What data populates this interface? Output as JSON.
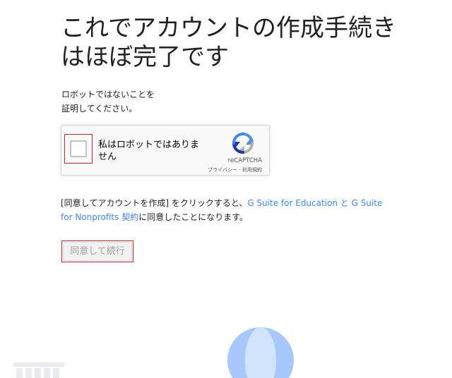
{
  "heading": {
    "title": "これでアカウントの作成手続きはほぼ完了です"
  },
  "instructions": {
    "text": "ロボットではないことを\n証明してください。"
  },
  "recaptcha": {
    "checkbox_label": "私はロボットではありません",
    "brand": "reCAPTCHA",
    "privacy_terms": "プライバシー - 利用規約",
    "checked": false
  },
  "agreement": {
    "prefix": "[同意してアカウントを作成] をクリックすると、",
    "link1": "G Suite for Education",
    "middle": " と ",
    "link2": "G Suite for Nonprofits 契約",
    "suffix": "に同意したことになります。"
  },
  "continue_button": {
    "label": "同意して続行"
  },
  "colors": {
    "link": "#4285f4",
    "highlight_border": "#e02020",
    "illustration_blue": "#a8c7fa"
  }
}
